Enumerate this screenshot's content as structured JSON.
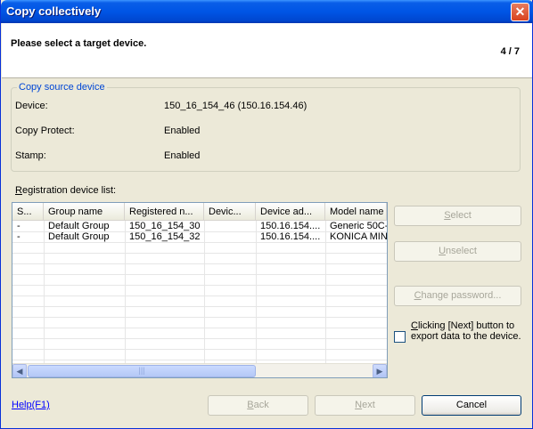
{
  "window": {
    "title": "Copy collectively",
    "close_glyph": "✕"
  },
  "header": {
    "title": "Please select a target device.",
    "step": "4 / 7"
  },
  "source": {
    "legend": "Copy source device",
    "device_label": "Device:",
    "device_value": "150_16_154_46 (150.16.154.46)",
    "protect_label": "Copy Protect:",
    "protect_value": "Enabled",
    "stamp_label": "Stamp:",
    "stamp_value": "Enabled"
  },
  "list": {
    "label_prefix": "R",
    "label_rest": "egistration device list:",
    "columns": [
      "S...",
      "Group name",
      "Registered n...",
      "Devic...",
      "Device ad...",
      "Model name"
    ],
    "rows": [
      [
        "-",
        "Default Group",
        "150_16_154_30",
        "",
        "150.16.154....",
        "Generic 50C-"
      ],
      [
        "-",
        "Default Group",
        "150_16_154_32",
        "",
        "150.16.154....",
        "KONICA MIN"
      ]
    ],
    "scroll_left": "◀",
    "scroll_right": "▶",
    "thumb_grip": "|||"
  },
  "buttons": {
    "select_u": "S",
    "select_rest": "elect",
    "unselect_u": "U",
    "unselect_rest": "nselect",
    "change_u": "C",
    "change_rest": "hange password...",
    "back_u": "B",
    "back_rest": "ack",
    "next_u": "N",
    "next_rest": "ext",
    "cancel": "Cancel"
  },
  "export": {
    "label_u": "C",
    "label_rest": "licking [Next] button to export data to the device."
  },
  "help": {
    "label": "Help(F1)"
  }
}
